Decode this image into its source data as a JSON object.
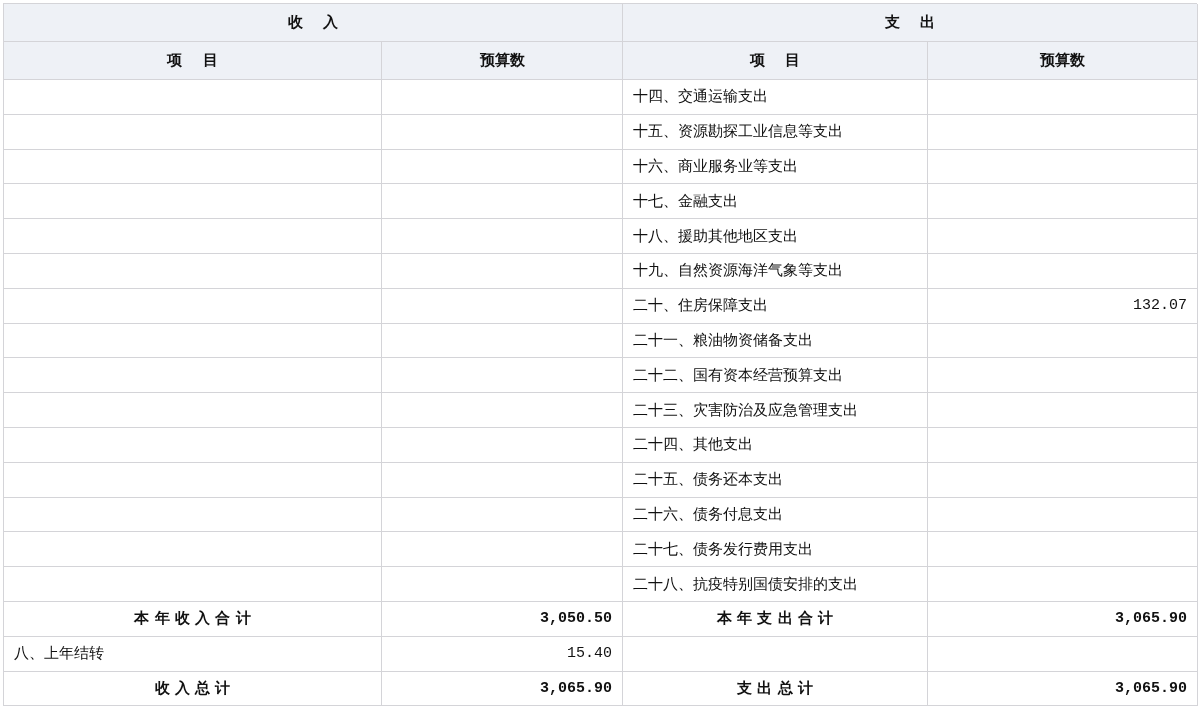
{
  "table": {
    "group_headers": [
      "收    入",
      "支    出"
    ],
    "columns": [
      "项    目",
      "预算数",
      "项    目",
      "预算数"
    ],
    "rows": [
      {
        "kind": "item",
        "expense_item": "十四、交通运输支出"
      },
      {
        "kind": "item",
        "expense_item": "十五、资源勘探工业信息等支出"
      },
      {
        "kind": "item",
        "expense_item": "十六、商业服务业等支出"
      },
      {
        "kind": "item",
        "expense_item": "十七、金融支出"
      },
      {
        "kind": "item",
        "expense_item": "十八、援助其他地区支出"
      },
      {
        "kind": "item",
        "expense_item": "十九、自然资源海洋气象等支出"
      },
      {
        "kind": "item",
        "expense_item": "二十、住房保障支出",
        "expense_amount": "132.07"
      },
      {
        "kind": "item",
        "expense_item": "二十一、粮油物资储备支出"
      },
      {
        "kind": "item",
        "expense_item": "二十二、国有资本经营预算支出"
      },
      {
        "kind": "item",
        "expense_item": "二十三、灾害防治及应急管理支出"
      },
      {
        "kind": "item",
        "expense_item": "二十四、其他支出"
      },
      {
        "kind": "item",
        "expense_item": "二十五、债务还本支出"
      },
      {
        "kind": "item",
        "expense_item": "二十六、债务付息支出"
      },
      {
        "kind": "item",
        "expense_item": "二十七、债务发行费用支出"
      },
      {
        "kind": "item",
        "expense_item": "二十八、抗疫特别国债安排的支出"
      },
      {
        "kind": "total",
        "income_item": "本 年 收 入 合 计",
        "income_amount": "3,050.50",
        "expense_item": "本 年 支 出 合 计",
        "expense_amount": "3,065.90"
      },
      {
        "kind": "item",
        "income_item": "八、上年结转",
        "income_amount": "15.40"
      },
      {
        "kind": "total",
        "income_item": "收 入 总 计",
        "income_amount": "3,065.90",
        "expense_item": "支 出 总 计",
        "expense_amount": "3,065.90"
      }
    ]
  }
}
